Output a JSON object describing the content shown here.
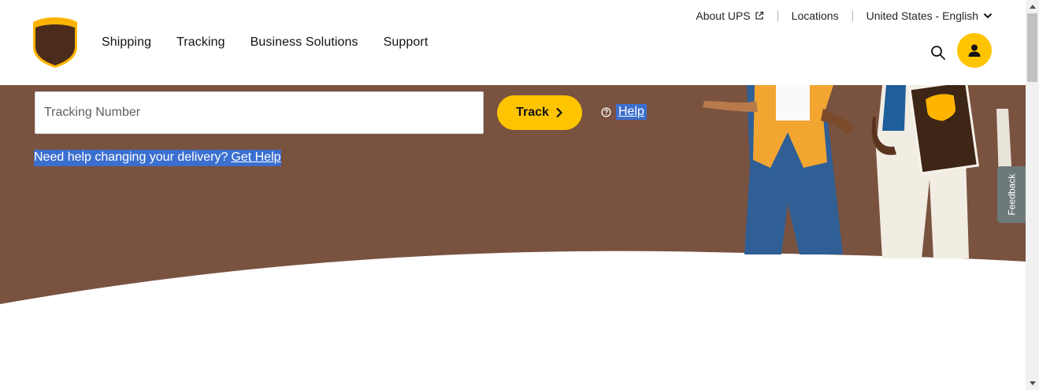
{
  "brand": {
    "logo_text": "ups",
    "colors": {
      "brown": "#7a5240",
      "gold": "#ffc400",
      "logo_brown": "#4b2c1c",
      "highlight": "#3b6fcf"
    }
  },
  "mainnav": {
    "items": [
      {
        "label": "Shipping"
      },
      {
        "label": "Tracking"
      },
      {
        "label": "Business Solutions"
      },
      {
        "label": "Support"
      }
    ]
  },
  "utility": {
    "about": "About UPS",
    "locations": "Locations",
    "language": "United States - English"
  },
  "icons": {
    "search": "search-icon",
    "account": "user-icon",
    "external": "external-link-icon",
    "chevron": "chevron-down-icon",
    "help": "question-circle-icon"
  },
  "tracking": {
    "placeholder": "Tracking Number",
    "button_label": "Track",
    "help_label": "Help",
    "delivery_prompt": "Need help changing your delivery?",
    "delivery_link": "Get Help"
  },
  "feedback": {
    "label": "Feedback"
  }
}
